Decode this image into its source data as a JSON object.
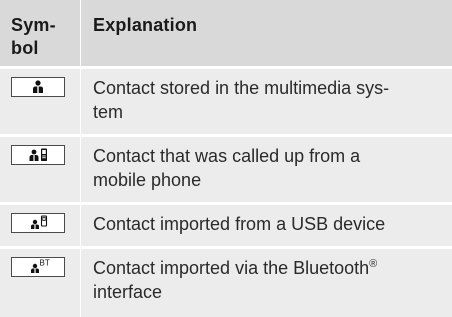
{
  "header": {
    "symbol_label": "Sym- bol",
    "explanation_label": "Explanation"
  },
  "rows": [
    {
      "icon": "contact-multimedia-icon",
      "text": "Contact stored in the multimedia sys- tem"
    },
    {
      "icon": "contact-mobile-phone-icon",
      "text": "Contact that was called up from a mobile phone"
    },
    {
      "icon": "contact-usb-icon",
      "text": "Contact imported from a USB device"
    },
    {
      "icon": "contact-bluetooth-icon",
      "text": "Contact imported via the Bluetooth® interface",
      "icon_badge": "BT"
    }
  ],
  "colors": {
    "header_bg": "#d9d9d9",
    "row_bg": "#ececec",
    "text": "#1a1a1a"
  }
}
